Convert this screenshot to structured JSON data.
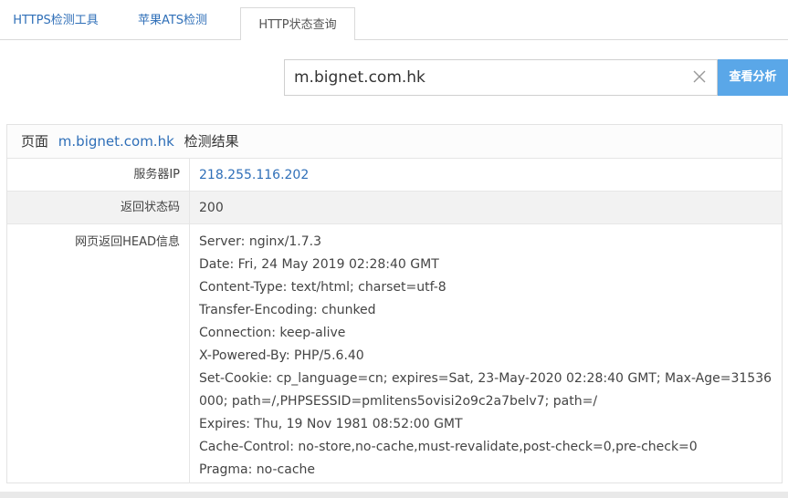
{
  "tabs": [
    {
      "label": "HTTPS检测工具"
    },
    {
      "label": "苹果ATS检测"
    },
    {
      "label": "HTTP状态查询"
    }
  ],
  "search": {
    "value": "m.bignet.com.hk",
    "button_label": "查看分析"
  },
  "result": {
    "prefix": "页面",
    "domain": "m.bignet.com.hk",
    "suffix": "检测结果",
    "rows": {
      "ip_label": "服务器IP",
      "ip_value": "218.255.116.202",
      "status_label": "返回状态码",
      "status_value": "200",
      "head_label": "网页返回HEAD信息"
    },
    "headers": [
      "Server: nginx/1.7.3",
      "Date: Fri, 24 May 2019 02:28:40 GMT",
      "Content-Type: text/html; charset=utf-8",
      "Transfer-Encoding: chunked",
      "Connection: keep-alive",
      "X-Powered-By: PHP/5.6.40",
      "Set-Cookie: cp_language=cn; expires=Sat, 23-May-2020 02:28:40 GMT; Max-Age=31536000; path=/,PHPSESSID=pmlitens5ovisi2o9c2a7belv7; path=/",
      "Expires: Thu, 19 Nov 1981 08:52:00 GMT",
      "Cache-Control: no-store,no-cache,must-revalidate,post-check=0,pre-check=0",
      "Pragma: no-cache"
    ]
  },
  "colors": {
    "accent": "#2f6fb8",
    "button": "#5aa7e8"
  }
}
